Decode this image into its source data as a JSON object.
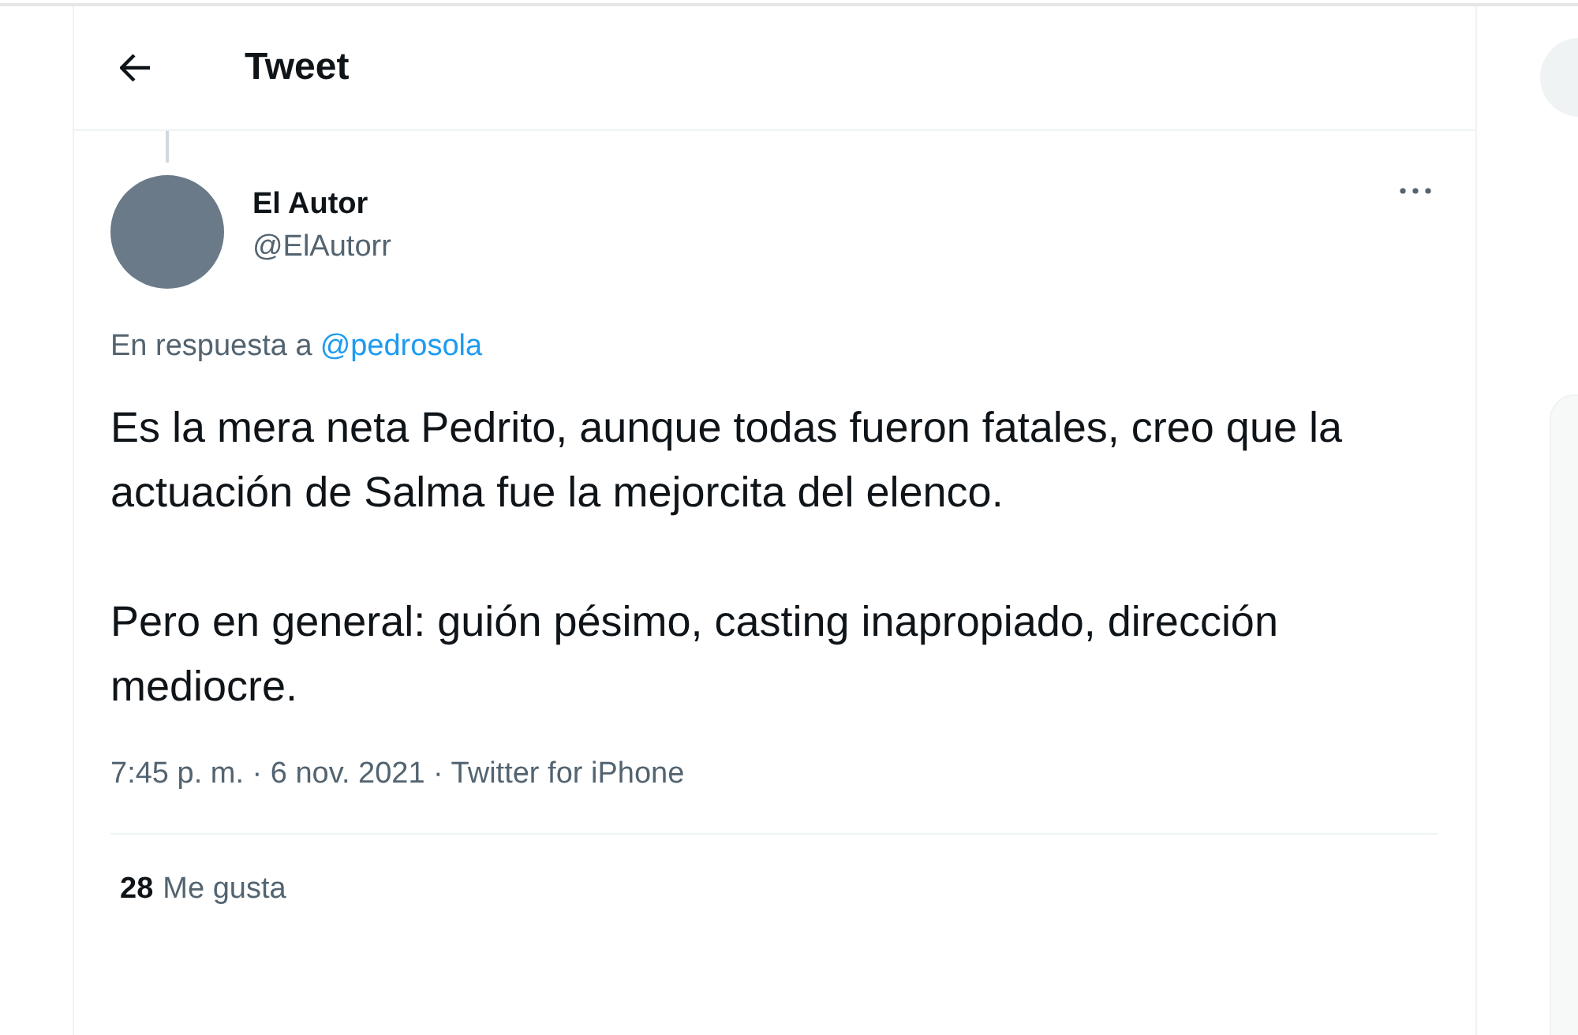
{
  "header": {
    "title": "Tweet"
  },
  "tweet": {
    "author": {
      "name": "El Autor",
      "handle": "@ElAutorr"
    },
    "reply_to": {
      "prefix": "En respuesta a",
      "mention": "@pedrosola"
    },
    "paragraphs": [
      "Es la mera neta Pedrito, aunque todas fueron fatales, creo que la actuación de Salma fue la mejorcita del elenco.",
      "Pero en general: guión pésimo, casting inapropiado, dirección mediocre."
    ],
    "meta": "7:45 p. m. · 6 nov. 2021 · Twitter for iPhone",
    "likes": {
      "count": "28",
      "label": "Me gusta"
    }
  }
}
